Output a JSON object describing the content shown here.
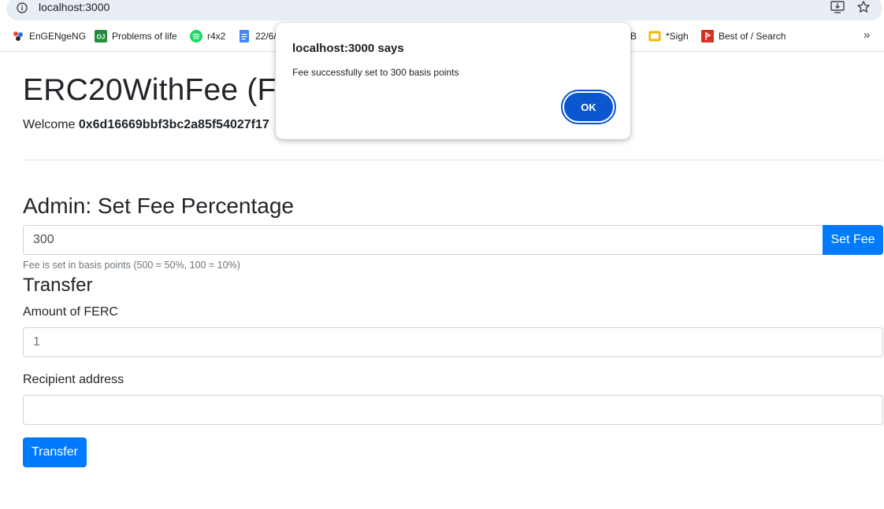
{
  "browser": {
    "url": "localhost:3000",
    "icons": {
      "site_info": "info-icon",
      "install": "install-app-icon",
      "bookmark": "star-icon",
      "overflow": "chevron-double-right-icon"
    }
  },
  "bookmarks": [
    {
      "label": "EnGENgeNG",
      "icon": "engenge-icon"
    },
    {
      "label": "Problems of life",
      "icon": "oj-icon"
    },
    {
      "label": "r4x2",
      "icon": "spotify-icon"
    },
    {
      "label": "22/6/",
      "icon": "docs-icon"
    },
    {
      "label": "B",
      "icon": ""
    },
    {
      "label": "*Sigh",
      "icon": "slides-icon"
    },
    {
      "label": "Best of / Search",
      "icon": "red-flag-icon"
    }
  ],
  "bookmarks_overflow_label": "»",
  "page": {
    "title": "ERC20WithFee (FE",
    "welcome_prefix": "Welcome ",
    "welcome_address": "0x6d16669bbf3bc2a85f54027f17"
  },
  "admin": {
    "heading": "Admin: Set Fee Percentage",
    "fee_value": "300",
    "set_fee_label": "Set Fee",
    "help_text": "Fee is set in basis points (500 = 50%, 100 = 10%)"
  },
  "transfer": {
    "heading": "Transfer",
    "amount_label": "Amount of FERC",
    "amount_placeholder": "1",
    "recipient_label": "Recipient address",
    "recipient_value": "",
    "button_label": "Transfer"
  },
  "alert": {
    "title": "localhost:3000 says",
    "message": "Fee successfully set to 300 basis points",
    "ok_label": "OK"
  },
  "colors": {
    "primary": "#007bff",
    "dialog_button": "#0b57d0",
    "omnibox_bg": "#e9eef6"
  }
}
